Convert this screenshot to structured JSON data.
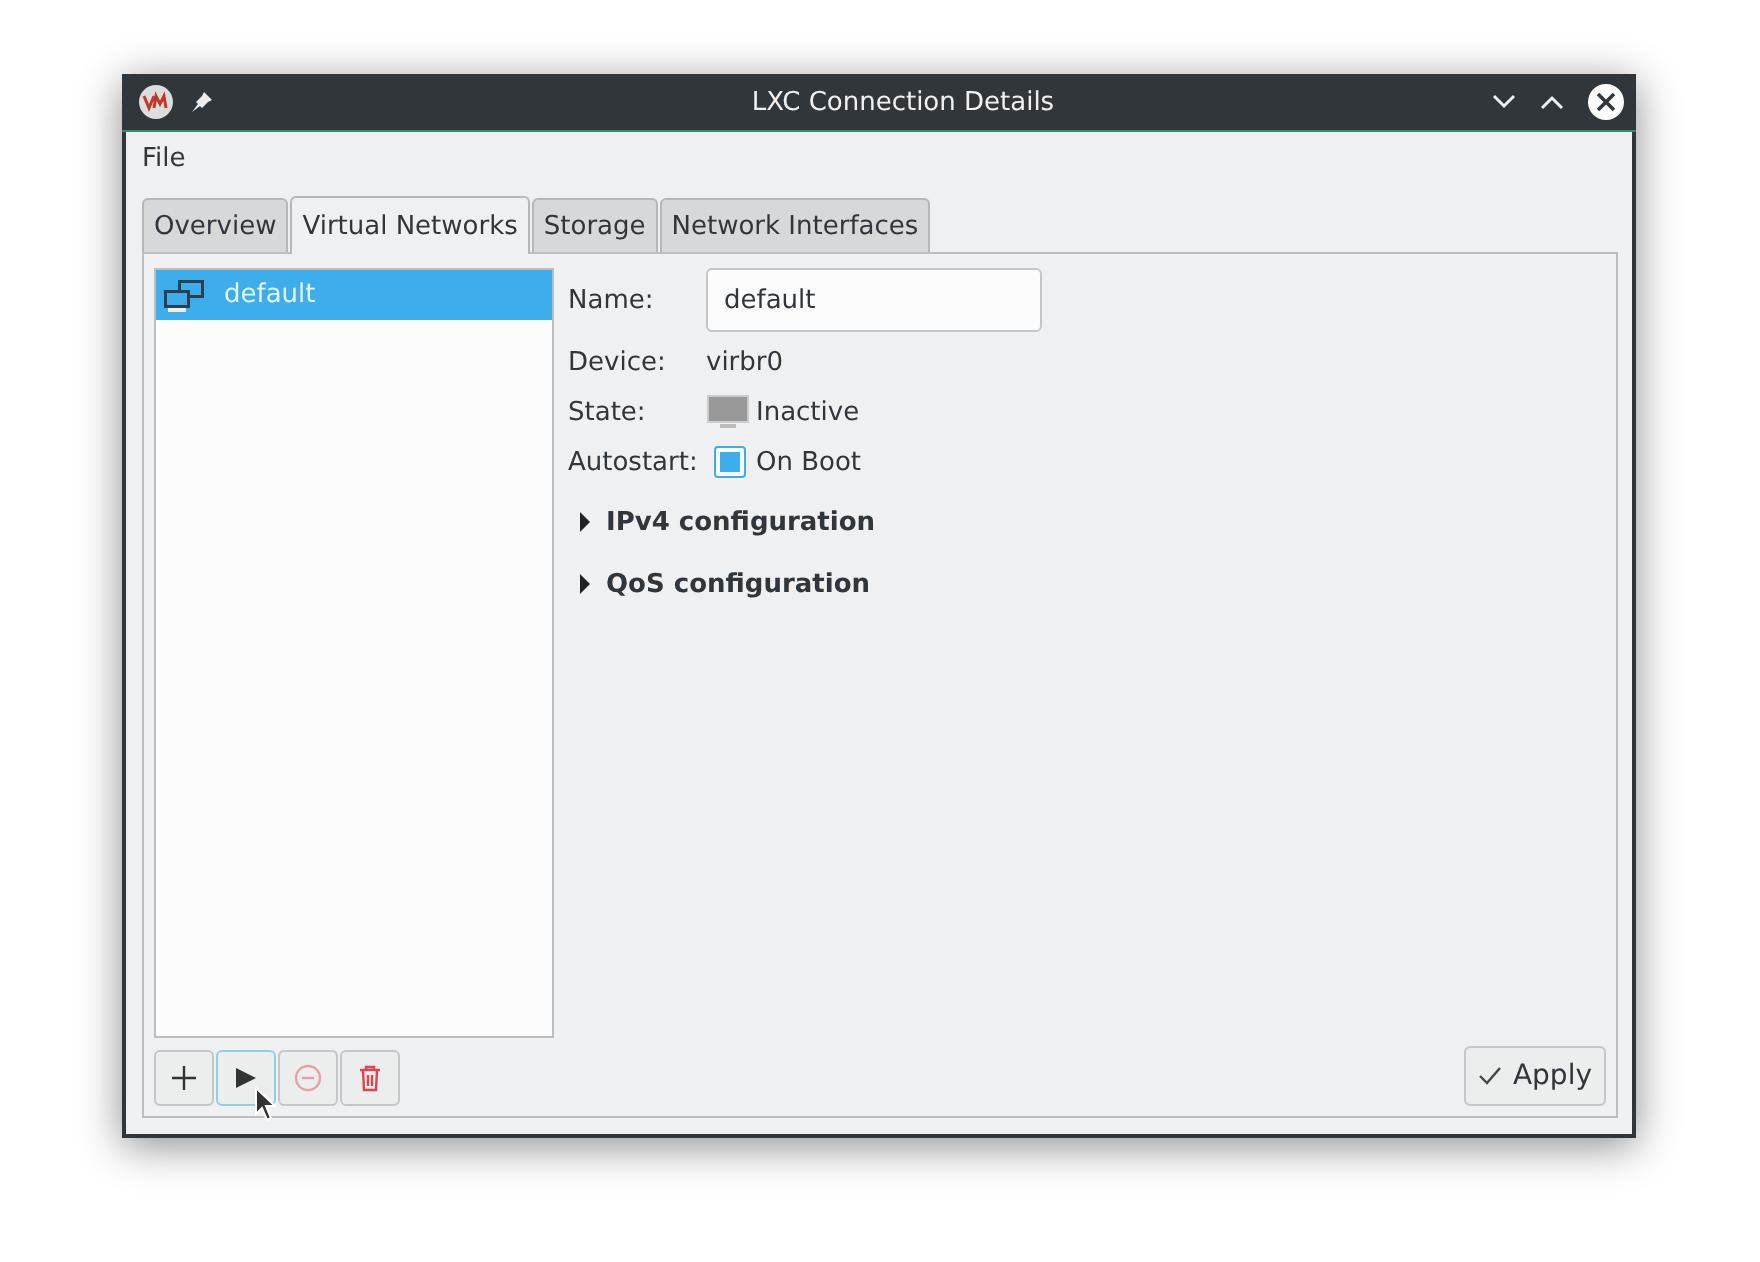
{
  "window": {
    "title": "LXC Connection Details"
  },
  "menu": [
    "File"
  ],
  "tabs": [
    {
      "label": "Overview",
      "selected": false
    },
    {
      "label": "Virtual Networks",
      "selected": true
    },
    {
      "label": "Storage",
      "selected": false
    },
    {
      "label": "Network Interfaces",
      "selected": false
    }
  ],
  "networks": [
    {
      "name": "default",
      "selected": true
    }
  ],
  "details": {
    "name_label": "Name:",
    "name_value": "default",
    "device_label": "Device:",
    "device_value": "virbr0",
    "state_label": "State:",
    "state_value": "Inactive",
    "autostart_label": "Autostart:",
    "autostart_value": "On Boot",
    "autostart_checked": true
  },
  "sections": [
    {
      "label": "IPv4 configuration",
      "expanded": false
    },
    {
      "label": "QoS configuration",
      "expanded": false
    }
  ],
  "toolbar": [
    {
      "kind": "add",
      "disabled": false
    },
    {
      "kind": "start",
      "disabled": false
    },
    {
      "kind": "stop",
      "disabled": true
    },
    {
      "kind": "delete",
      "disabled": false
    }
  ],
  "apply_button": "Apply"
}
